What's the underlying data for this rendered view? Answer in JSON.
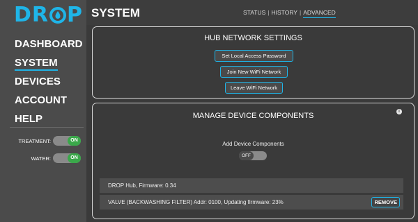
{
  "brand": {
    "logo_text_pre": "DR",
    "logo_text_post": "P",
    "accent_color": "#1fb5e8"
  },
  "sidebar": {
    "items": [
      {
        "label": "DASHBOARD"
      },
      {
        "label": "SYSTEM"
      },
      {
        "label": "DEVICES"
      },
      {
        "label": "ACCOUNT"
      },
      {
        "label": "HELP"
      }
    ],
    "active_index": 1,
    "toggles": [
      {
        "label": "TREATMENT:",
        "state": "ON"
      },
      {
        "label": "WATER:",
        "state": "ON"
      }
    ]
  },
  "header": {
    "title": "SYSTEM",
    "tabs": [
      {
        "label": "STATUS"
      },
      {
        "label": "HISTORY"
      },
      {
        "label": "ADVANCED"
      }
    ],
    "active_tab": "ADVANCED"
  },
  "network_panel": {
    "title": "HUB NETWORK SETTINGS",
    "buttons": [
      {
        "label": "Set Local Access Password"
      },
      {
        "label": "Join New WiFi Network"
      },
      {
        "label": "Leave WiFi Network"
      }
    ]
  },
  "components_panel": {
    "title": "MANAGE DEVICE COMPONENTS",
    "info_icon": "info-icon",
    "add_label": "Add Device Components",
    "add_toggle_state": "OFF",
    "rows": [
      {
        "text": "DROP Hub,  Firmware: 0.34"
      },
      {
        "text": "VALVE (BACKWASHING FILTER)  Addr: 0100, Updating firmware: 23%",
        "action": "REMOVE"
      }
    ]
  }
}
